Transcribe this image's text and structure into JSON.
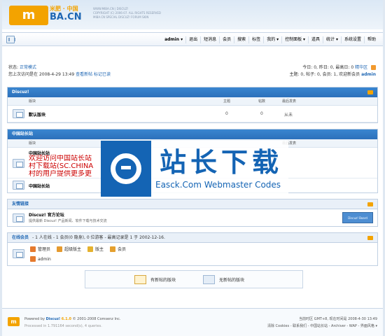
{
  "header": {
    "logo_mark": "m",
    "logo_cn": "米肥 · 中国",
    "logo_en": "BA.CN",
    "copy_lines": [
      "WWW.MIBA.CN | DISCUZ!",
      "COPYRIGHT (C) 2006-07. ALL RIGHTS RESERVED",
      "MIBA.CN SPECIAL DISCUZ! FORUM SKIN"
    ]
  },
  "nav": {
    "items": [
      "admin ▾",
      "退出",
      "短消息",
      "会员",
      "搜索",
      "标签",
      "我的 ▾",
      "控制面板 ▾",
      "道具",
      "统计 ▾",
      "系统设置",
      "帮助"
    ]
  },
  "status": {
    "mode_label": "状态:",
    "mode_value": "正常模式",
    "last_visit_label": "您上次访问是在",
    "last_visit_time": "2008-4-29 13:49",
    "view_new": "查看新帖",
    "mark_read": "标记已读",
    "today_stats": "今日: 0, 昨日: 0, 最高日: 0",
    "hot_link": "精华区",
    "totals": "主题: 0, 帖子: 0, 会员: 1, 欢迎新会员",
    "new_member": "admin"
  },
  "sections": {
    "discuz": {
      "title": "Discuz!",
      "cols": {
        "forum": "版块",
        "threads": "主题",
        "posts": "帖数",
        "last": "最后发表"
      },
      "forums": [
        {
          "name": "默认版块",
          "threads": "0",
          "posts": "0",
          "last": "从未"
        }
      ]
    },
    "china": {
      "title": "中国站长站",
      "cols": {
        "forum": "版块",
        "last": "最后发表"
      },
      "forums": [
        {
          "name": "中国站长站",
          "desc_lines": [
            "欢迎访问中国站长站",
            "村下载站(SC.CHINA",
            "村的用户提供更多更"
          ]
        },
        {
          "name": "中国站长站"
        }
      ]
    },
    "links": {
      "title": "友情链接",
      "item_name": "Discuz! 官方论坛",
      "item_desc": "提供最新 Discuz! 产品新闻、软件下载与技术交流",
      "badge_text": "Discuz! Board"
    },
    "online": {
      "title": "在线会员",
      "summary": "- 1 人在线 - 1 会员(0 隐身), 0 位游客 - 最高记录是 1 于 2002-12-16.",
      "groups": [
        {
          "label": "管理员",
          "color": "#e57a2e"
        },
        {
          "label": "超级版主",
          "color": "#e59a2e"
        },
        {
          "label": "版主",
          "color": "#e5b22e"
        },
        {
          "label": "会员",
          "color": "#e5a02e"
        }
      ],
      "online_user": "admin"
    }
  },
  "legend": {
    "new_posts": "有新帖的版块",
    "no_new_posts": "无新帖的版块"
  },
  "watermark": {
    "title": "站长下载",
    "subtitle": "Easck.Com Webmaster Codes"
  },
  "footer": {
    "powered_prefix": "Powered by",
    "product": "Discuz!",
    "version": "6.1.0",
    "copyright": "© 2001-2008 Comsenz Inc.",
    "processed": "Processed in 1.791164 second(s), 4 queries.",
    "timezone": "当前时区 GMT+8, 现在时间是 2008-4-30 13:49",
    "links": "清除 Cookies - 联系我们 - 中国站长站 - Archiver - WAP - 界面风格 ▾"
  }
}
